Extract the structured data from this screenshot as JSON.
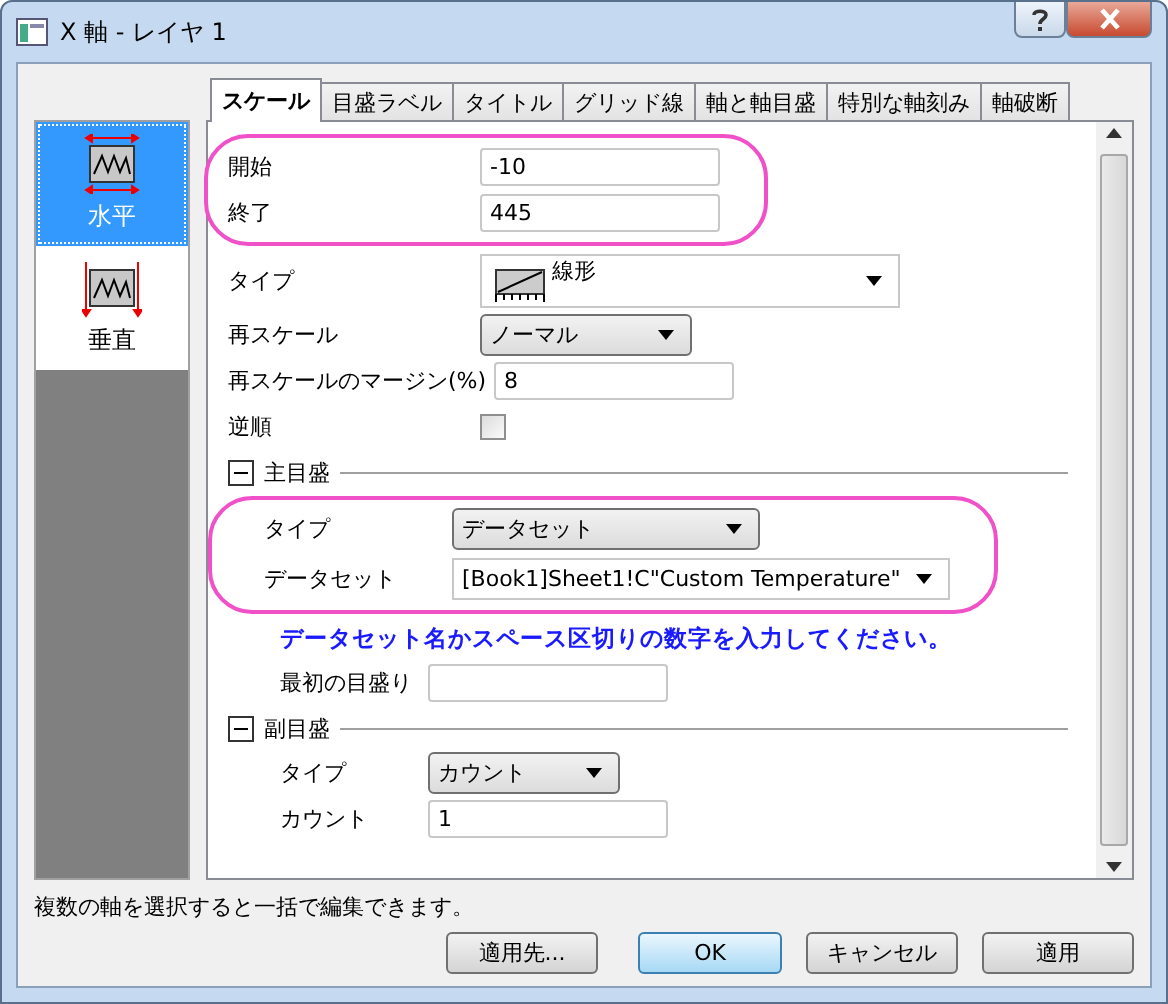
{
  "window": {
    "title": "X 軸 - レイヤ 1"
  },
  "sidebar": {
    "items": [
      {
        "label": "水平",
        "selected": true
      },
      {
        "label": "垂直",
        "selected": false
      }
    ]
  },
  "tabs": [
    {
      "label": "スケール",
      "selected": true
    },
    {
      "label": "目盛ラベル",
      "selected": false
    },
    {
      "label": "タイトル",
      "selected": false
    },
    {
      "label": "グリッド線",
      "selected": false
    },
    {
      "label": "軸と軸目盛",
      "selected": false
    },
    {
      "label": "特別な軸刻み",
      "selected": false
    },
    {
      "label": "軸破断",
      "selected": false
    }
  ],
  "content": [
    {
      "kind": "group",
      "highlighted": true,
      "rows": [
        {
          "kind": "text",
          "label": "開始",
          "value": "-10"
        },
        {
          "kind": "text",
          "label": "終了",
          "value": "445"
        }
      ]
    },
    {
      "kind": "scale-type",
      "label": "タイプ",
      "value": "線形"
    },
    {
      "kind": "select",
      "label": "再スケール",
      "value": "ノーマル"
    },
    {
      "kind": "text",
      "label": "再スケールのマージン(%)",
      "value": "8"
    },
    {
      "kind": "checkbox",
      "label": "逆順",
      "checked": false
    },
    {
      "kind": "section",
      "label": "主目盛",
      "expanded": true,
      "children": [
        {
          "kind": "group",
          "highlighted": true,
          "rows": [
            {
              "kind": "select",
              "label": "タイプ",
              "value": "データセット"
            },
            {
              "kind": "combo",
              "label": "データセット",
              "value": "[Book1]Sheet1!C\"Custom Temperature\""
            }
          ]
        },
        {
          "kind": "note",
          "text": "データセット名かスペース区切りの数字を入力してください。"
        },
        {
          "kind": "text",
          "label": "最初の目盛り"
        }
      ]
    },
    {
      "kind": "section",
      "label": "副目盛",
      "expanded": true,
      "children": [
        {
          "kind": "select",
          "label": "タイプ",
          "value": "カウント"
        },
        {
          "kind": "text",
          "label": "カウント",
          "value": "1"
        }
      ]
    }
  ],
  "hint": "複数の軸を選択すると一括で編集できます。",
  "buttons": [
    {
      "label": "適用先...",
      "default": false
    },
    {
      "label": "OK",
      "default": true
    },
    {
      "label": "キャンセル",
      "default": false
    },
    {
      "label": "適用",
      "default": false
    }
  ]
}
